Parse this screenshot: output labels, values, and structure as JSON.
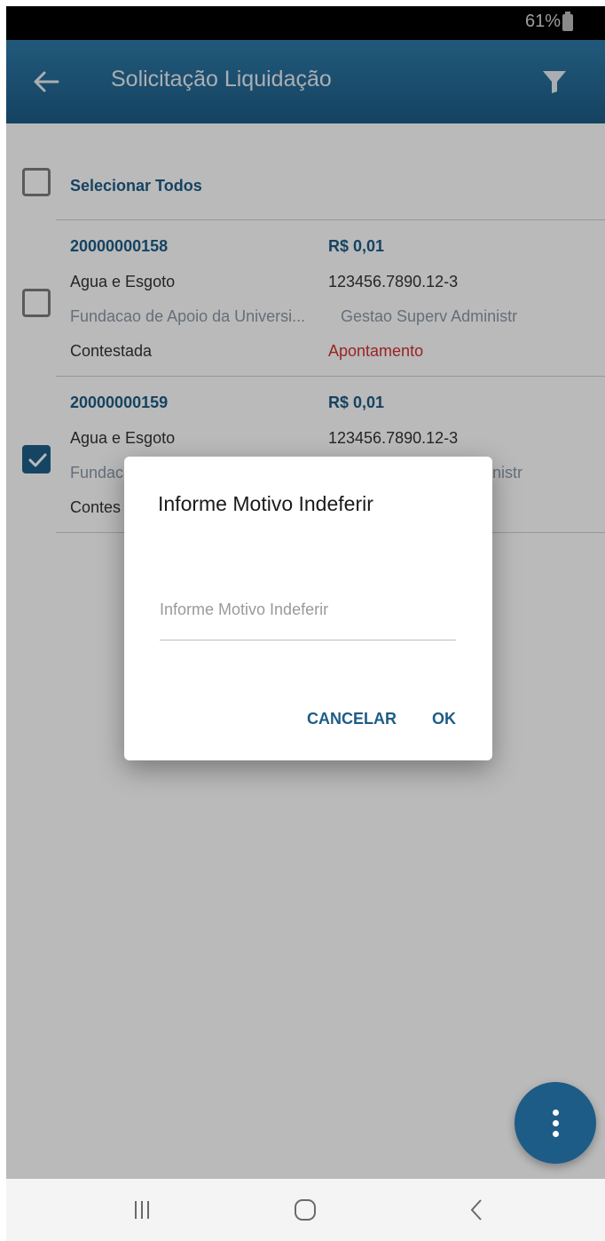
{
  "status_bar": {
    "battery": "61%"
  },
  "app_bar": {
    "title": "Solicitação Liquidação",
    "back_icon": "arrow-left-icon",
    "filter_icon": "filter-icon"
  },
  "select_all": {
    "label": "Selecionar Todos",
    "checked": false
  },
  "items": [
    {
      "id": "20000000158",
      "amount": "R$ 0,01",
      "category": "Agua e Esgoto",
      "account": "123456.7890.12-3",
      "org": "Fundacao de Apoio da Universi...",
      "dept": "Gestao Superv Administr",
      "status": "Contestada",
      "type": "Apontamento",
      "checked": false
    },
    {
      "id": "20000000159",
      "amount": "R$ 0,01",
      "category": "Agua e Esgoto",
      "account": "123456.7890.12-3",
      "org": "Fundac",
      "dept": "nistr",
      "status": "Contes",
      "checked": true
    }
  ],
  "dialog": {
    "title": "Informe Motivo Indeferir",
    "input_placeholder": "Informe Motivo Indeferir",
    "input_value": "",
    "cancel_label": "CANCELAR",
    "ok_label": "OK"
  },
  "fab": {
    "icon": "more-vertical-icon"
  },
  "nav_bar": {
    "recents_icon": "recents-icon",
    "home_icon": "home-icon",
    "back_icon": "back-chevron-icon"
  },
  "colors": {
    "primary": "#1d5c86",
    "appbar_top": "#2e7aa8",
    "accent_red": "#d3302f"
  }
}
